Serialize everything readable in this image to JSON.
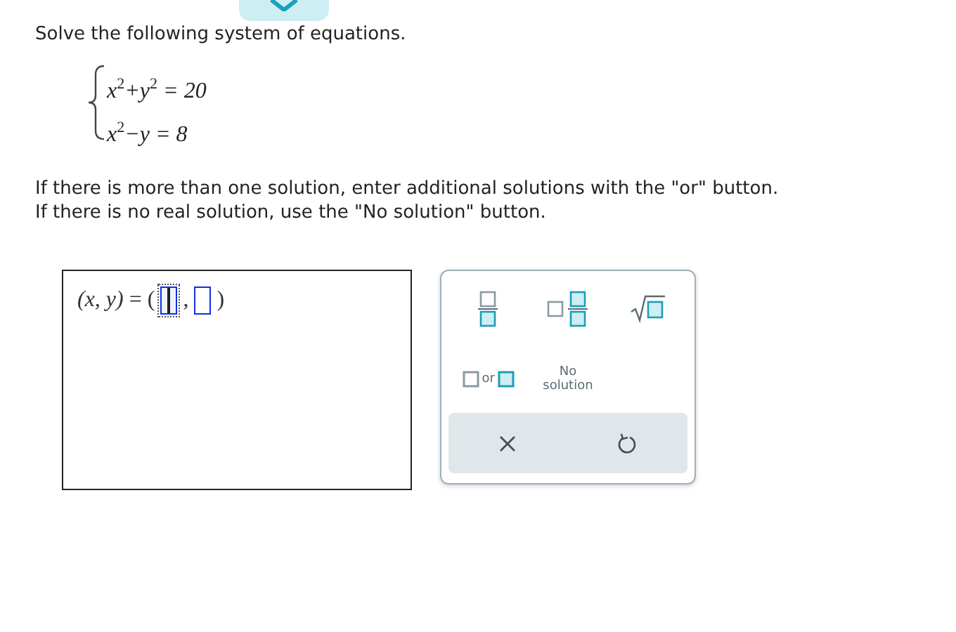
{
  "prompt": "Solve the following system of equations.",
  "equations": [
    "x$^{2}$+y$^{2}$ = 20",
    "x$^{2}$−y = 8"
  ],
  "instructions": [
    "If there is more than one solution, enter additional solutions with the \"or\" button.",
    "If there is no real solution, use the \"No solution\" button."
  ],
  "answer": {
    "label": "(x, y)",
    "equals": "=",
    "open": "(",
    "separator": ",",
    "close": ")",
    "slots": [
      {
        "selected": true
      },
      {
        "selected": false
      }
    ]
  },
  "keypad": {
    "keys": [
      {
        "kind": "fraction"
      },
      {
        "kind": "mixed"
      },
      {
        "kind": "sqrt"
      },
      {
        "kind": "or",
        "label": "or"
      },
      {
        "kind": "nosolution",
        "label": "No solution"
      }
    ],
    "actions": [
      {
        "kind": "clear"
      },
      {
        "kind": "undo"
      }
    ]
  }
}
